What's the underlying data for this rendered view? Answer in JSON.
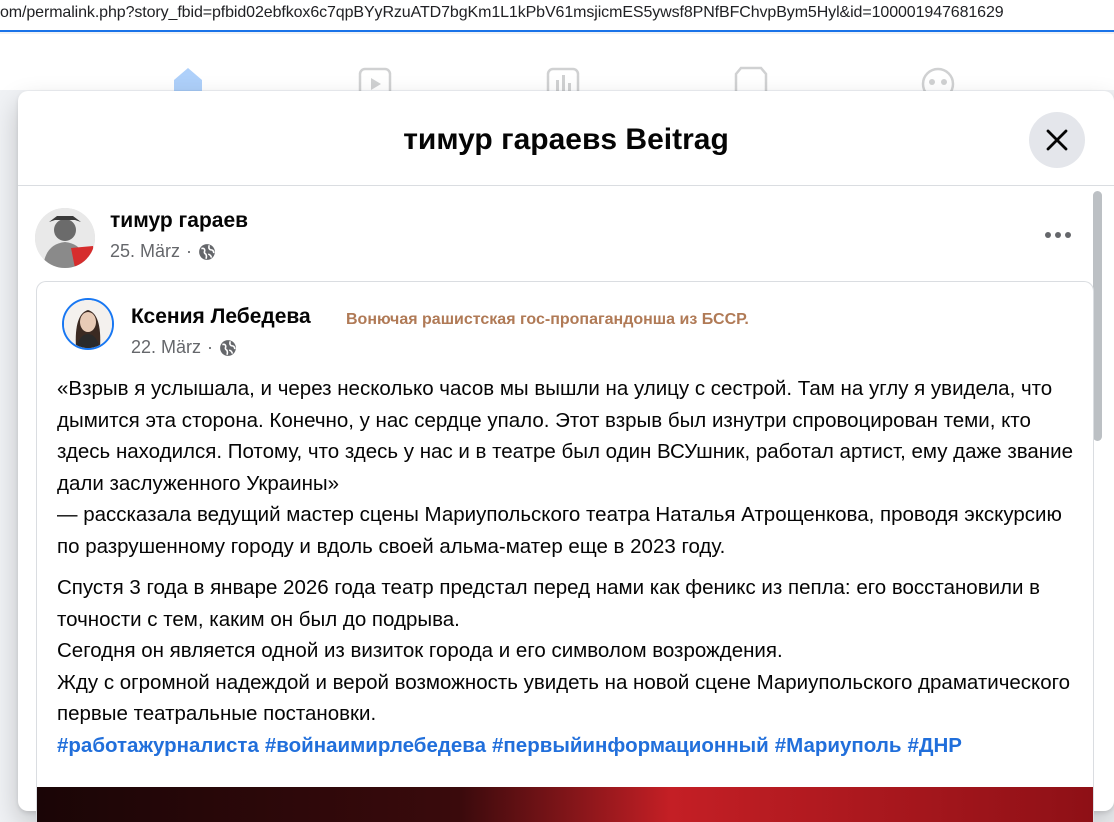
{
  "browser": {
    "url": "om/permalink.php?story_fbid=pfbid02ebfkox6c7qpBYyRzuATD7bgKm1L1kPbV61msjicmES5ywsf8PNfBFChvpBym5Hyl&id=100001947681629"
  },
  "nav": {
    "icons": [
      "home-icon",
      "video-icon",
      "chart-icon",
      "marketplace-icon",
      "gaming-icon"
    ],
    "active_color": "#1877f2",
    "inactive_color": "#65676b"
  },
  "modal": {
    "title": "тимур гараевs Beitrag",
    "close_icon": "close-icon"
  },
  "post": {
    "author": "тимур гараев",
    "date": "25. März",
    "separator": "·",
    "privacy_icon": "globe-icon",
    "more_icon": "more-icon",
    "shared": {
      "author": "Ксения Лебедева",
      "tag": "Вонючая рашистская гос-пропагандонша из БССР.",
      "date": "22. März",
      "separator": "·",
      "privacy_icon": "globe-icon",
      "paragraphs": [
        "«Взрыв я услышала, и через несколько часов мы вышли на улицу с сестрой. Там на углу я увидела, что дымится эта сторона. Конечно, у нас сердце упало. Этот взрыв был изнутри спровоцирован теми, кто здесь находился. Потому, что здесь у нас и в театре был один ВСУшник, работал артист, ему даже звание дали заслуженного Украины»",
        " — рассказала ведущий мастер сцены Мариупольского театра Наталья Атрощенкова, проводя экскурсию по разрушенному городу и вдоль своей альма-матер еще в 2023 году.",
        "Спустя 3 года в январе 2026 года театр предстал перед нами как феникс из пепла: его восстановили в точности с тем, каким он был до подрыва.",
        "Сегодня он является одной из визиток города и его символом возрождения.",
        "Жду с огромной надеждой и верой возможность увидеть на новой сцене Мариупольского драматического первые театральные постановки."
      ],
      "hashtags": [
        "#работажурналиста",
        "#войнаимирлебедева",
        "#первыйинформационный",
        "#Мариуполь",
        "#ДНР"
      ]
    }
  }
}
